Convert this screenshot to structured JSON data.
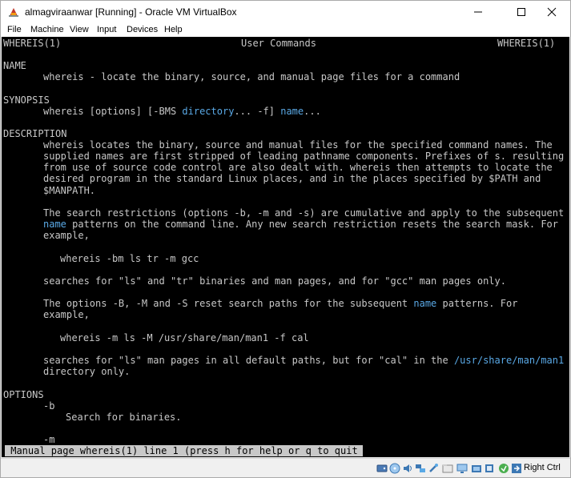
{
  "window": {
    "title": "almagviraanwar [Running] - Oracle VM VirtualBox",
    "controls": {
      "minimize": "—",
      "maximize": "☐",
      "close": "✕"
    }
  },
  "menubar": {
    "items": [
      "File",
      "Machine",
      "View",
      "Input",
      "Devices",
      "Help"
    ]
  },
  "terminal": {
    "header": {
      "left": "WHEREIS(1)",
      "center": "User Commands",
      "right": "WHEREIS(1)"
    },
    "sections": {
      "name_heading": "NAME",
      "name_text": "whereis - locate the binary, source, and manual page files for a command",
      "synopsis_heading": "SYNOPSIS",
      "synopsis": {
        "cmd": "whereis [options] [-BMS ",
        "dir": "directory",
        "mid": "... -f] ",
        "name": "name",
        "tail": "..."
      },
      "description_heading": "DESCRIPTION",
      "desc1": [
        "whereis locates the binary, source and manual files for the specified command names. The",
        "supplied names are first stripped of leading pathname components. Prefixes of s. resulting",
        "from use of source code control are also dealt with. whereis then attempts to locate the",
        "desired program in the standard Linux places, and in the places specified by $PATH and",
        "$MANPATH."
      ],
      "desc2_line1": "The search restrictions (options -b, -m and -s) are cumulative and apply to the subsequent",
      "desc2_line2_name": "name",
      "desc2_line2_rest": " patterns on the command line. Any new search restriction resets the search mask. For",
      "desc2_line3": "example,",
      "example1": "whereis -bm ls tr -m gcc",
      "desc3": "searches for \"ls\" and \"tr\" binaries and man pages, and for \"gcc\" man pages only.",
      "desc4_pre": "The options -B, -M and -S reset search paths for the subsequent ",
      "desc4_name": "name",
      "desc4_post": " patterns. For",
      "desc4_line2": "example,",
      "example2": "whereis -m ls -M /usr/share/man/man1 -f cal",
      "desc5_pre": "searches for \"ls\" man pages in all default paths, but for \"cal\" in the ",
      "desc5_path": "/usr/share/man/man1",
      "desc5_line2": "directory only.",
      "options_heading": "OPTIONS",
      "opt_b": "-b",
      "opt_b_desc": "Search for binaries.",
      "opt_m": "-m"
    },
    "status_line": " Manual page whereis(1) line 1 (press h for help or q to quit)"
  },
  "statusbar": {
    "icons": [
      "hard-disk-icon",
      "optical-drive-icon",
      "audio-icon",
      "network-icon",
      "usb-icon",
      "shared-folder-icon",
      "display-icon",
      "video-capture-icon",
      "cpu-icon",
      "mouse-integration-icon",
      "host-key-icon"
    ],
    "host_key": "Right Ctrl"
  },
  "colors": {
    "terminal_bg": "#000000",
    "terminal_fg": "#c8c8c8",
    "highlight": "#5aa9e6"
  }
}
